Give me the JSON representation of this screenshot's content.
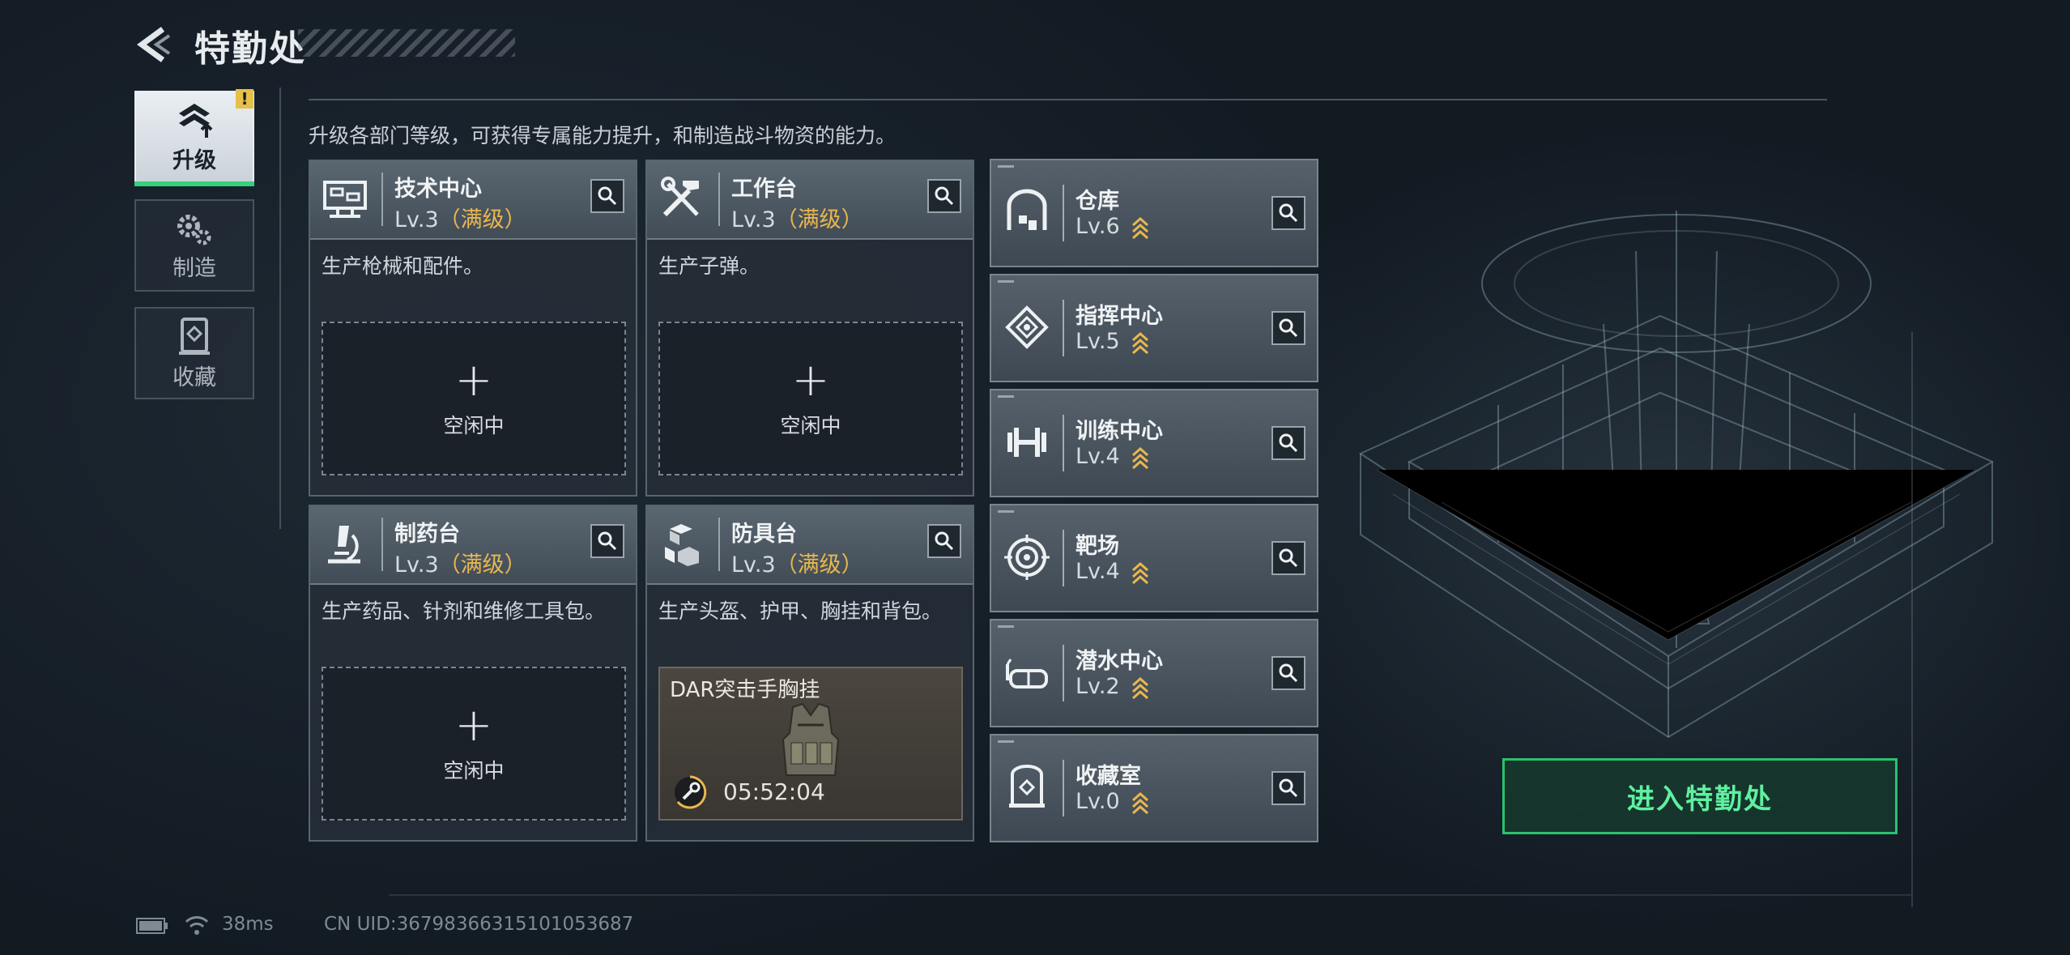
{
  "header": {
    "title": "特勤处"
  },
  "nav": {
    "items": [
      {
        "label": "升级"
      },
      {
        "label": "制造"
      },
      {
        "label": "收藏"
      }
    ],
    "alert": "!"
  },
  "subtitle": "升级各部门等级，可获得专属能力提升，和制造战斗物资的能力。",
  "departments": [
    {
      "name": "技术中心",
      "level": "Lv.3",
      "max": "（满级）",
      "desc": "生产枪械和配件。",
      "slot": {
        "plus": "+",
        "status": "空闲中"
      }
    },
    {
      "name": "工作台",
      "level": "Lv.3",
      "max": "（满级）",
      "desc": "生产子弹。",
      "slot": {
        "plus": "+",
        "status": "空闲中"
      }
    },
    {
      "name": "制药台",
      "level": "Lv.3",
      "max": "（满级）",
      "desc": "生产药品、针剂和维修工具包。",
      "slot": {
        "plus": "+",
        "status": "空闲中"
      }
    },
    {
      "name": "防具台",
      "level": "Lv.3",
      "max": "（满级）",
      "desc": "生产头盔、护甲、胸挂和背包。",
      "crafting": {
        "item": "DAR突击手胸挂",
        "timer": "05:52:04"
      }
    }
  ],
  "buildings": [
    {
      "name": "仓库",
      "level": "Lv.6"
    },
    {
      "name": "指挥中心",
      "level": "Lv.5"
    },
    {
      "name": "训练中心",
      "level": "Lv.4"
    },
    {
      "name": "靶场",
      "level": "Lv.4"
    },
    {
      "name": "潜水中心",
      "level": "Lv.2"
    },
    {
      "name": "收藏室",
      "level": "Lv.0"
    }
  ],
  "enter_button": "进入特勤处",
  "status": {
    "ping": "38ms",
    "uid": "CN UID:3679836631510105368​7"
  },
  "colors": {
    "accent_green": "#33d17a",
    "max_level": "#e9b74f",
    "alert": "#e5c04a"
  }
}
